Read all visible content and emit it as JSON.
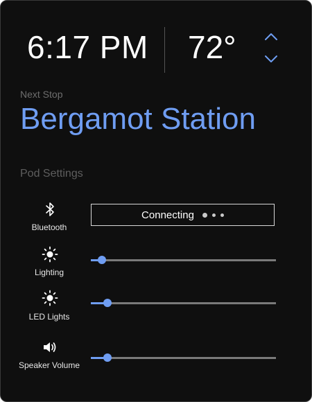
{
  "header": {
    "time": "6:17 PM",
    "temperature": "72°"
  },
  "next_stop": {
    "label": "Next Stop",
    "station": "Bergamot Station"
  },
  "pod_settings": {
    "label": "Pod Settings",
    "bluetooth": {
      "label": "Bluetooth",
      "status": "Connecting"
    },
    "lighting": {
      "label": "Lighting",
      "level_percent": 6
    },
    "led_lights": {
      "label": "LED Lights",
      "level_percent": 9
    },
    "speaker_volume": {
      "label": "Speaker Volume",
      "level_percent": 9
    }
  },
  "colors": {
    "accent": "#6f9df2",
    "background": "#0f0f0f",
    "muted": "#6e6e6e"
  },
  "icons": [
    "chevron-up-icon",
    "chevron-down-icon",
    "bluetooth-icon",
    "sun-icon",
    "speaker-icon"
  ]
}
